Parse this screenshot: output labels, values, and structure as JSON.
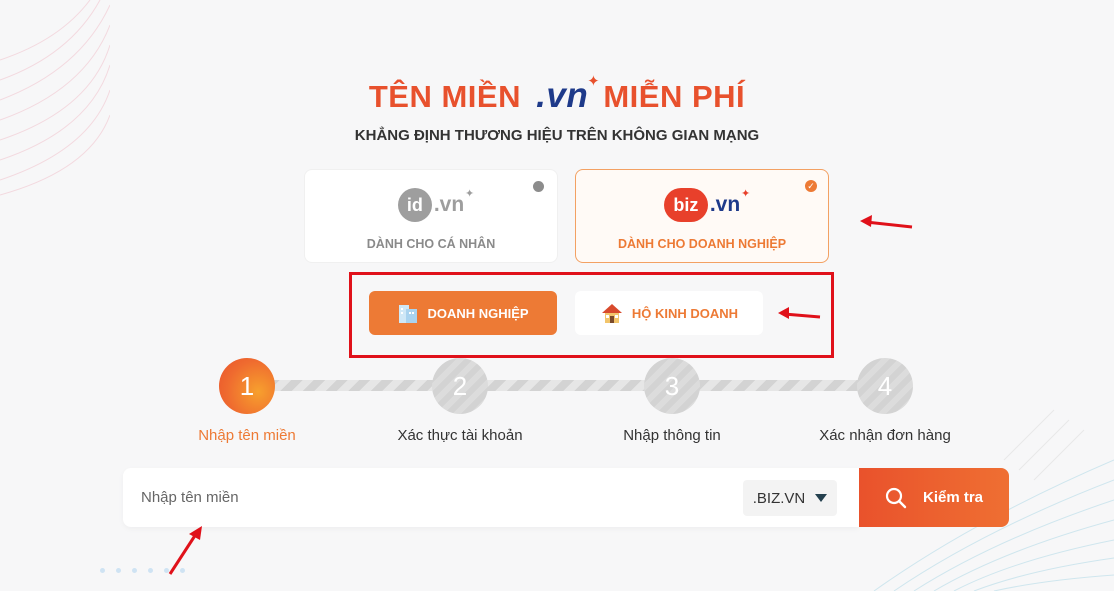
{
  "header": {
    "title_part1": "TÊN MIỀN",
    "title_vn": ".vn",
    "title_part2": "MIỄN PHÍ",
    "subtitle": "KHẲNG ĐỊNH THƯƠNG HIỆU TRÊN KHÔNG GIAN MẠNG"
  },
  "cards": {
    "personal": {
      "logo_prefix": "id",
      "logo_suffix": ".vn",
      "caption": "DÀNH CHO CÁ NHÂN",
      "selected": false
    },
    "business": {
      "logo_prefix": "biz",
      "logo_suffix": ".vn",
      "caption": "DÀNH CHO DOANH NGHIỆP",
      "selected": true
    }
  },
  "segments": {
    "business": {
      "label": "DOANH NGHIỆP",
      "icon": "building-icon",
      "active": true
    },
    "household": {
      "label": "HỘ KINH DOANH",
      "icon": "house-icon",
      "active": false
    }
  },
  "steps": [
    {
      "number": "1",
      "label": "Nhập tên miền",
      "active": true
    },
    {
      "number": "2",
      "label": "Xác thực tài khoản",
      "active": false
    },
    {
      "number": "3",
      "label": "Nhập thông tin",
      "active": false
    },
    {
      "number": "4",
      "label": "Xác nhận đơn hàng",
      "active": false
    }
  ],
  "search": {
    "placeholder": "Nhập tên miền",
    "tld_selected": ".BIZ.VN",
    "button_label": "Kiểm tra"
  },
  "colors": {
    "accent": "#ed7a35",
    "title_red": "#e8512d",
    "vn_blue": "#1e3a8a",
    "annotation_red": "#e0111a"
  }
}
